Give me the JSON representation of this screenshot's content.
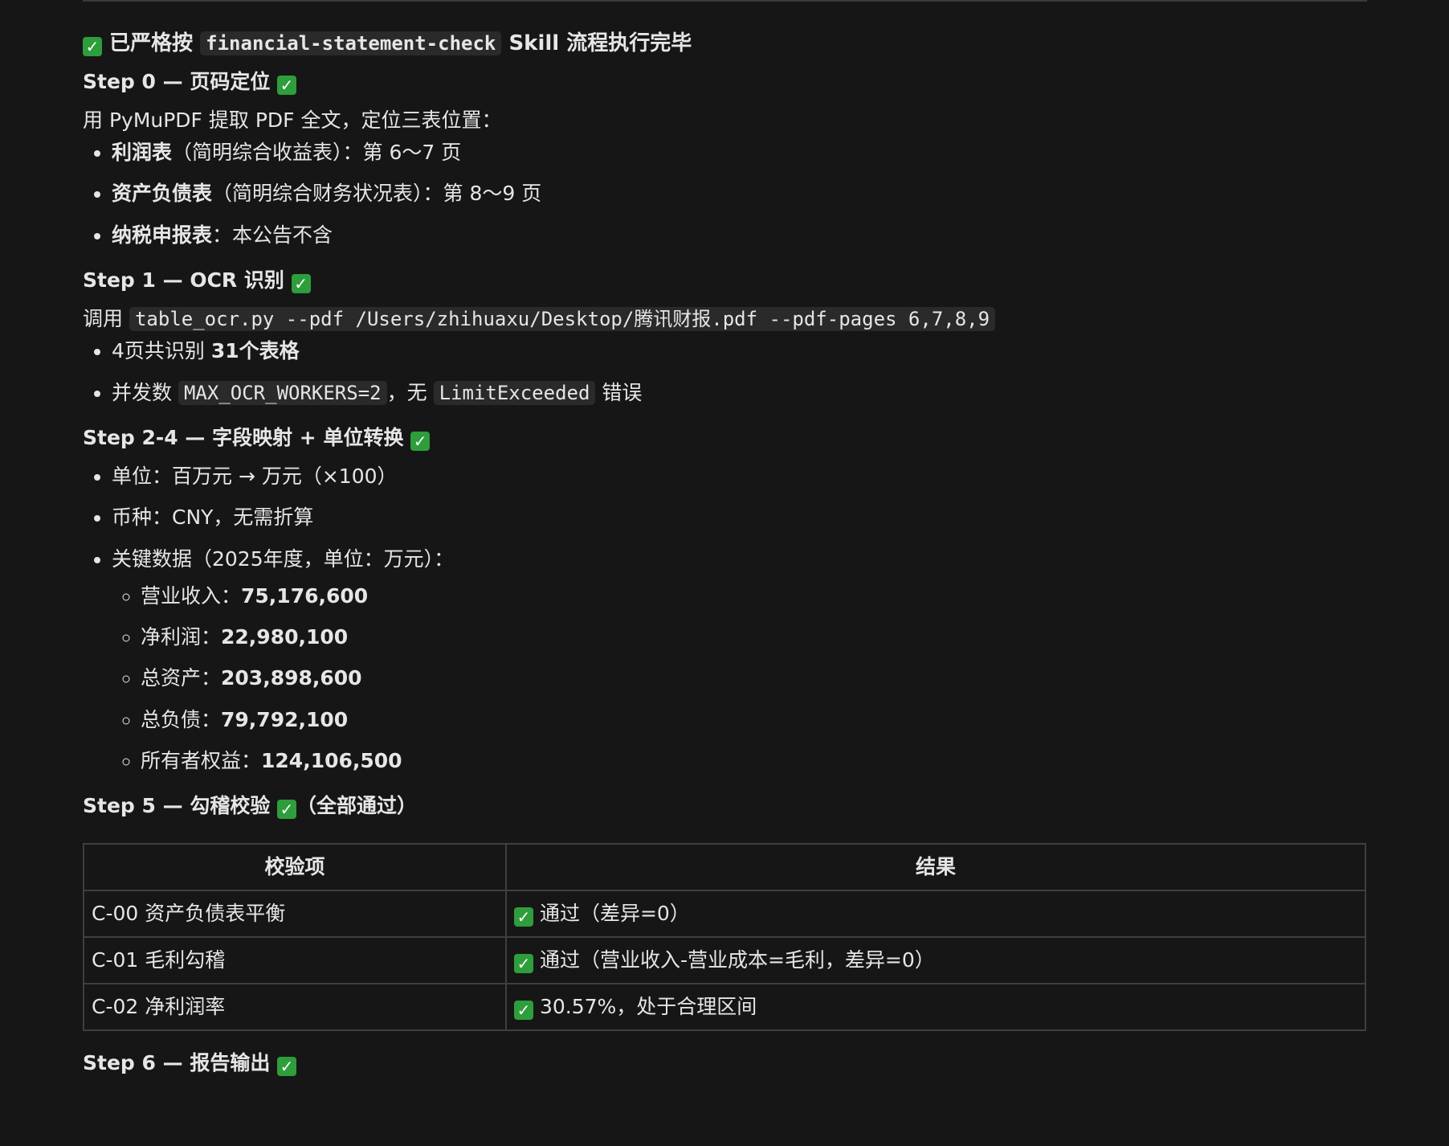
{
  "title": {
    "prefix": "已严格按",
    "skill_name": "financial-statement-check",
    "suffix": "Skill 流程执行完毕"
  },
  "step0": {
    "heading": "Step 0 — 页码定位",
    "intro": "用 PyMuPDF 提取 PDF 全文，定位三表位置：",
    "items": [
      {
        "bold": "利润表",
        "text": "（简明综合收益表）：第 6～7 页"
      },
      {
        "bold": "资产负债表",
        "text": "（简明综合财务状况表）：第 8～9 页"
      },
      {
        "bold": "纳税申报表",
        "text": "：本公告不含"
      }
    ]
  },
  "step1": {
    "heading": "Step 1 — OCR 识别",
    "intro_prefix": "调用",
    "command": "table_ocr.py --pdf /Users/zhihuaxu/Desktop/腾讯财报.pdf --pdf-pages 6,7,8,9",
    "item1_prefix": "4页共识别",
    "item1_bold": "31个表格",
    "item2_prefix": "并发数",
    "item2_code1": "MAX_OCR_WORKERS=2",
    "item2_mid": "，无",
    "item2_code2": "LimitExceeded",
    "item2_suffix": "错误"
  },
  "step24": {
    "heading": "Step 2-4 — 字段映射 + 单位转换",
    "items": [
      "单位：百万元 → 万元（×100）",
      "币种：CNY，无需折算",
      "关键数据（2025年度，单位：万元）："
    ],
    "key_data": [
      {
        "label": "营业收入：",
        "value": "75,176,600"
      },
      {
        "label": "净利润：",
        "value": "22,980,100"
      },
      {
        "label": "总资产：",
        "value": "203,898,600"
      },
      {
        "label": "总负债：",
        "value": "79,792,100"
      },
      {
        "label": "所有者权益：",
        "value": "124,106,500"
      }
    ]
  },
  "step5": {
    "heading": "Step 5 — 勾稽校验",
    "heading_suffix": "（全部通过）",
    "table": {
      "headers": [
        "校验项",
        "结果"
      ],
      "rows": [
        {
          "item": "C-00 资产负债表平衡",
          "result": "通过（差异=0）"
        },
        {
          "item": "C-01 毛利勾稽",
          "result": "通过（营业收入-营业成本=毛利，差异=0）"
        },
        {
          "item": "C-02 净利润率",
          "result": "30.57%，处于合理区间"
        }
      ]
    }
  },
  "step6": {
    "heading": "Step 6 — 报告输出"
  },
  "icons": {
    "check": "check-mark-icon",
    "check_color": "#2e9d3b"
  }
}
